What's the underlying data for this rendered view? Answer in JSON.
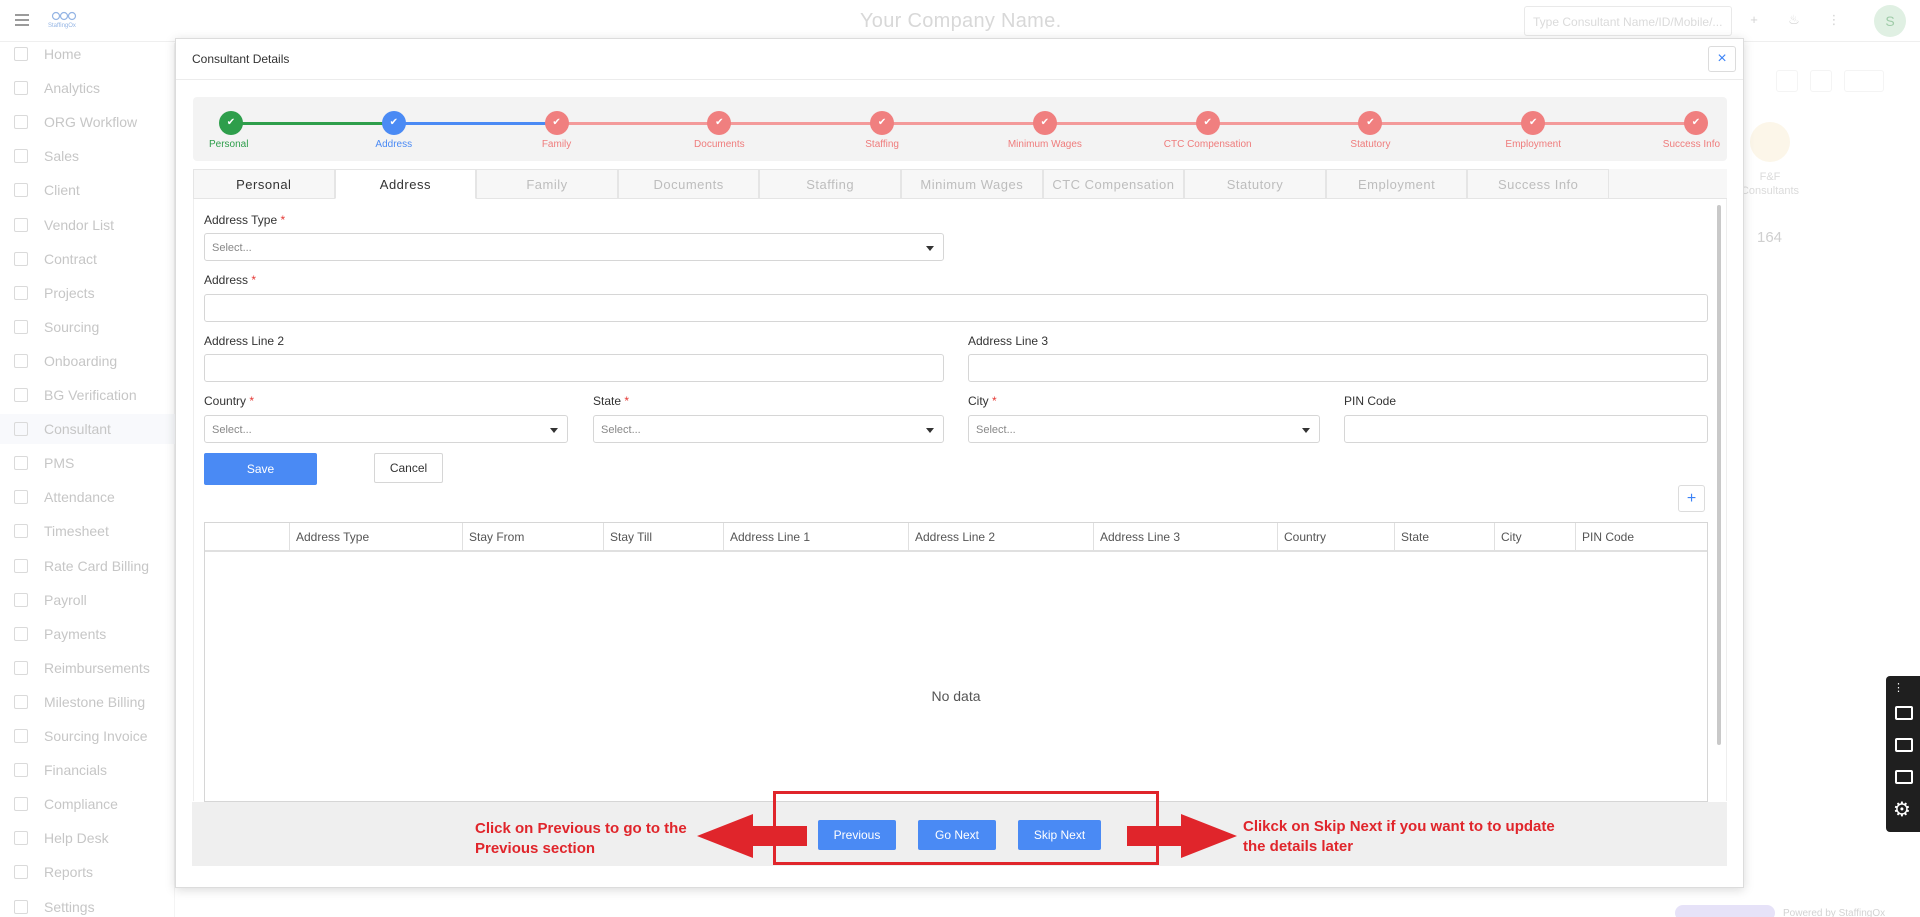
{
  "header": {
    "company": "Your Company Name.",
    "search_placeholder": "Type Consultant Name/ID/Mobile/...",
    "avatar_letter": "S",
    "logo_text": "StaffingOx"
  },
  "sidebar": {
    "items": [
      {
        "label": "Home",
        "icon": "home-icon"
      },
      {
        "label": "Analytics",
        "icon": "chart-icon"
      },
      {
        "label": "ORG Workflow",
        "icon": "workflow-icon"
      },
      {
        "label": "Sales",
        "icon": "briefcase-icon"
      },
      {
        "label": "Client",
        "icon": "client-icon"
      },
      {
        "label": "Vendor List",
        "icon": "list-icon"
      },
      {
        "label": "Contract",
        "icon": "document-icon"
      },
      {
        "label": "Projects",
        "icon": "grid-icon"
      },
      {
        "label": "Sourcing",
        "icon": "people-icon"
      },
      {
        "label": "Onboarding",
        "icon": "onboarding-icon"
      },
      {
        "label": "BG Verification",
        "icon": "user-check-icon"
      },
      {
        "label": "Consultant",
        "icon": "consultant-icon"
      },
      {
        "label": "PMS",
        "icon": "pms-icon"
      },
      {
        "label": "Attendance",
        "icon": "calendar-icon"
      },
      {
        "label": "Timesheet",
        "icon": "clock-icon"
      },
      {
        "label": "Rate Card Billing",
        "icon": "rate-card-icon"
      },
      {
        "label": "Payroll",
        "icon": "payroll-icon"
      },
      {
        "label": "Payments",
        "icon": "rupee-icon"
      },
      {
        "label": "Reimbursements",
        "icon": "reimburse-icon"
      },
      {
        "label": "Milestone Billing",
        "icon": "milestone-icon"
      },
      {
        "label": "Sourcing Invoice",
        "icon": "invoice-icon"
      },
      {
        "label": "Financials",
        "icon": "finance-icon"
      },
      {
        "label": "Compliance",
        "icon": "compliance-icon"
      },
      {
        "label": "Help Desk",
        "icon": "help-icon"
      },
      {
        "label": "Reports",
        "icon": "reports-icon"
      },
      {
        "label": "Settings",
        "icon": "gear-icon"
      }
    ]
  },
  "background": {
    "card_label": "F&F Consultants",
    "card_value": "164",
    "powered_by": "Powered by StaffingOx"
  },
  "modal": {
    "title": "Consultant Details",
    "close_label": "×",
    "steps": [
      {
        "label": "Personal",
        "status": "done",
        "color": "#2e9e4b"
      },
      {
        "label": "Address",
        "status": "active",
        "color": "#4a8af4"
      },
      {
        "label": "Family",
        "status": "pending",
        "color": "#f07f7f"
      },
      {
        "label": "Documents",
        "status": "pending",
        "color": "#f07f7f"
      },
      {
        "label": "Staffing",
        "status": "pending",
        "color": "#f07f7f"
      },
      {
        "label": "Minimum Wages",
        "status": "pending",
        "color": "#f07f7f"
      },
      {
        "label": "CTC Compensation",
        "status": "pending",
        "color": "#f07f7f"
      },
      {
        "label": "Statutory",
        "status": "pending",
        "color": "#f07f7f"
      },
      {
        "label": "Employment",
        "status": "pending",
        "color": "#f07f7f"
      },
      {
        "label": "Success Info",
        "status": "pending",
        "color": "#f07f7f"
      }
    ],
    "tabs": [
      "Personal",
      "Address",
      "Family",
      "Documents",
      "Staffing",
      "Minimum Wages",
      "CTC Compensation",
      "Statutory",
      "Employment",
      "Success Info"
    ],
    "form": {
      "address_type_label": "Address Type",
      "address_type_placeholder": "Select...",
      "address_label": "Address",
      "address_line2_label": "Address Line 2",
      "address_line3_label": "Address Line 3",
      "country_label": "Country",
      "country_placeholder": "Select...",
      "state_label": "State",
      "state_placeholder": "Select...",
      "city_label": "City",
      "city_placeholder": "Select...",
      "pin_label": "PIN Code",
      "required_mark": "*",
      "save_label": "Save",
      "cancel_label": "Cancel",
      "add_label": "+"
    },
    "table": {
      "columns": [
        "",
        "Address Type",
        "Stay From",
        "Stay Till",
        "Address Line 1",
        "Address Line 2",
        "Address Line 3",
        "Country",
        "State",
        "City",
        "PIN Code"
      ],
      "empty_text": "No data"
    },
    "footer": {
      "previous_label": "Previous",
      "next_label": "Go Next",
      "skip_label": "Skip Next"
    }
  },
  "annotations": {
    "left": "Click on Previous to go to the Previous section",
    "left_line1": "Click on Previous to go to the",
    "left_line2": "Previous section",
    "right_line1": "Clikck on Skip Next if you want to to update",
    "right_line2": "the details later",
    "color": "#e0252b"
  }
}
